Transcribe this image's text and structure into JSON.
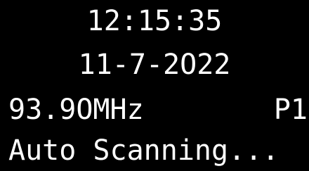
{
  "display": {
    "time": "12:15:35",
    "date": "11-7-2O22",
    "frequency": "93.9OMHz",
    "preset": "P1",
    "status": "Auto Scanning..."
  },
  "colors": {
    "background": "#000000",
    "text": "#ffffff"
  }
}
